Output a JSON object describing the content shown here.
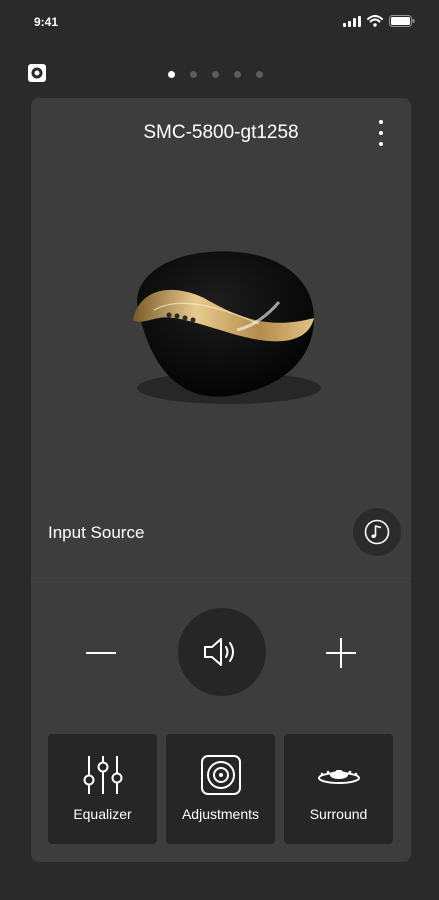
{
  "status_bar": {
    "time": "9:41",
    "icons": [
      "signal-icon",
      "wifi-icon",
      "battery-icon"
    ]
  },
  "pager": {
    "count": 5,
    "active_index": 0
  },
  "card": {
    "device_name": "SMC-5800-gt1258",
    "menu_icon": "more-vertical-icon",
    "image": "speaker-image"
  },
  "input_source": {
    "label": "Input Source",
    "icon": "music-note-icon"
  },
  "volume": {
    "minus_icon": "minus-icon",
    "speaker_icon": "volume-icon",
    "plus_icon": "plus-icon"
  },
  "features": [
    {
      "label": "Equalizer",
      "icon": "equalizer-icon"
    },
    {
      "label": "Adjustments",
      "icon": "speaker-adjust-icon"
    },
    {
      "label": "Surround",
      "icon": "surround-icon"
    }
  ],
  "colors": {
    "background": "#2a2a2a",
    "card": "#3d3d3d",
    "button": "#262626",
    "accent_gold": "#c8a564"
  }
}
